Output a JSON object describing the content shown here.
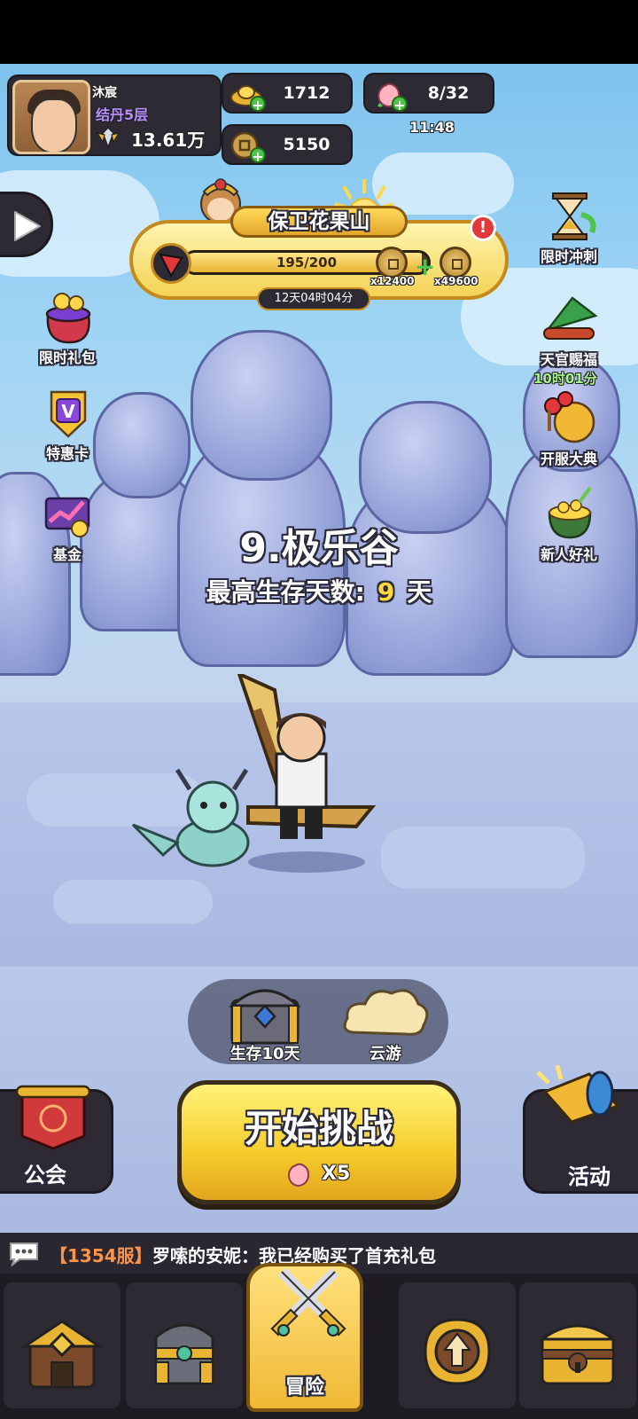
{
  "player": {
    "name": "沐宸",
    "rank": "结丹5层",
    "power": "13.61万"
  },
  "resources": {
    "gold_ingot": "1712",
    "copper_coin": "5150",
    "peach_stamina": "8/32",
    "peach_timer": "11:48"
  },
  "event": {
    "title": "保卫花果山",
    "progress_text": "195/200",
    "progress_fraction": 0.975,
    "reward_left_qty": "x12400",
    "reward_right_qty": "x49600",
    "time_left": "12天04时04分",
    "alert": "!"
  },
  "left_buttons": [
    {
      "label": "限时礼包",
      "icon": "gift-bag-icon"
    },
    {
      "label": "特惠卡",
      "icon": "vip-card-icon"
    },
    {
      "label": "基金",
      "icon": "fund-chart-icon"
    }
  ],
  "right_buttons": [
    {
      "label": "限时冲刺",
      "icon": "hourglass-icon"
    },
    {
      "label": "天官赐福",
      "icon": "fan-scroll-icon",
      "timer": "10时01分"
    },
    {
      "label": "开服大典",
      "icon": "drum-icon"
    },
    {
      "label": "新人好礼",
      "icon": "gold-pot-icon"
    }
  ],
  "stage": {
    "name": "9.极乐谷",
    "best_label": "最高生存天数:",
    "best_days": "9",
    "best_unit": "天"
  },
  "tray": {
    "chest_label": "生存10天",
    "cloud_label": "云游"
  },
  "start": {
    "label": "开始挑战",
    "cost": "X5"
  },
  "guild_label": "公会",
  "activity_label": "活动",
  "chat": {
    "server": "【1354服】",
    "message": "罗嗦的安妮：我已经购买了首充礼包"
  },
  "nav": {
    "active_label": "冒险",
    "items": [
      "shop-icon",
      "equipment-icon",
      "adventure-icon",
      "upgrade-icon",
      "treasure-icon"
    ]
  },
  "colors": {
    "accent_gold": "#f5cc2a",
    "rank_purple": "#b68cff",
    "timer_green": "#a5f28b",
    "chat_orange": "#ff9446"
  }
}
